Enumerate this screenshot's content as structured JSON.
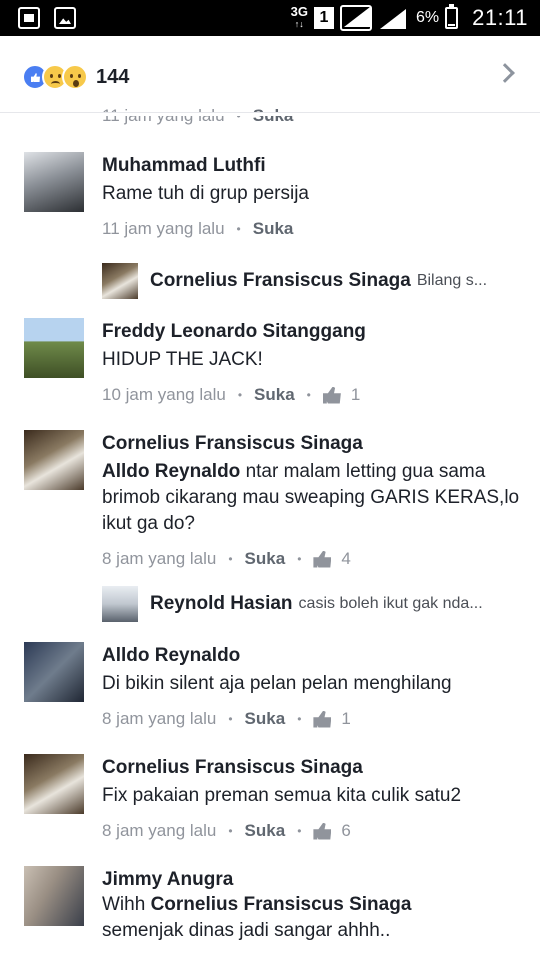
{
  "status_bar": {
    "network": "3G",
    "network_sub": "↑↓",
    "sim_slot": "1",
    "battery_percent": "6%",
    "time": "21:11"
  },
  "header": {
    "reaction_icons": [
      "like-icon",
      "sad-icon",
      "wow-icon"
    ],
    "reaction_count": "144"
  },
  "top_meta": {
    "time": "11 jam yang lalu",
    "like_label": "Suka"
  },
  "comments": [
    {
      "name": "Muhammad Luthfi",
      "text": "Rame tuh di grup persija",
      "time": "11 jam yang lalu",
      "like_label": "Suka",
      "likes": ""
    },
    {
      "name": "Freddy Leonardo Sitanggang",
      "text": "HIDUP THE JACK!",
      "time": "10 jam yang lalu",
      "like_label": "Suka",
      "likes": "1"
    },
    {
      "name": "Cornelius Fransiscus Sinaga",
      "mention": "Alldo Reynaldo",
      "text": " ntar malam letting gua sama brimob cikarang mau sweaping GARIS KERAS,lo ikut ga do?",
      "time": "8 jam yang lalu",
      "like_label": "Suka",
      "likes": "4"
    },
    {
      "name": "Alldo Reynaldo",
      "text": "Di bikin silent aja pelan pelan menghilang",
      "time": "8 jam yang lalu",
      "like_label": "Suka",
      "likes": "1"
    },
    {
      "name": "Cornelius Fransiscus Sinaga",
      "text": "Fix pakaian preman semua kita culik satu2",
      "time": "8 jam yang lalu",
      "like_label": "Suka",
      "likes": "6"
    },
    {
      "name": "Jimmy Anugra",
      "text_prefix": "Wihh ",
      "mention": "Cornelius Fransiscus Sinaga",
      "text": "semenjak dinas jadi sangar ahhh.."
    }
  ],
  "replies": [
    {
      "name": "Cornelius Fransiscus Sinaga",
      "text": "Bilang s..."
    },
    {
      "name": "Reynold Hasian",
      "text": "casis boleh ikut gak nda..."
    }
  ]
}
